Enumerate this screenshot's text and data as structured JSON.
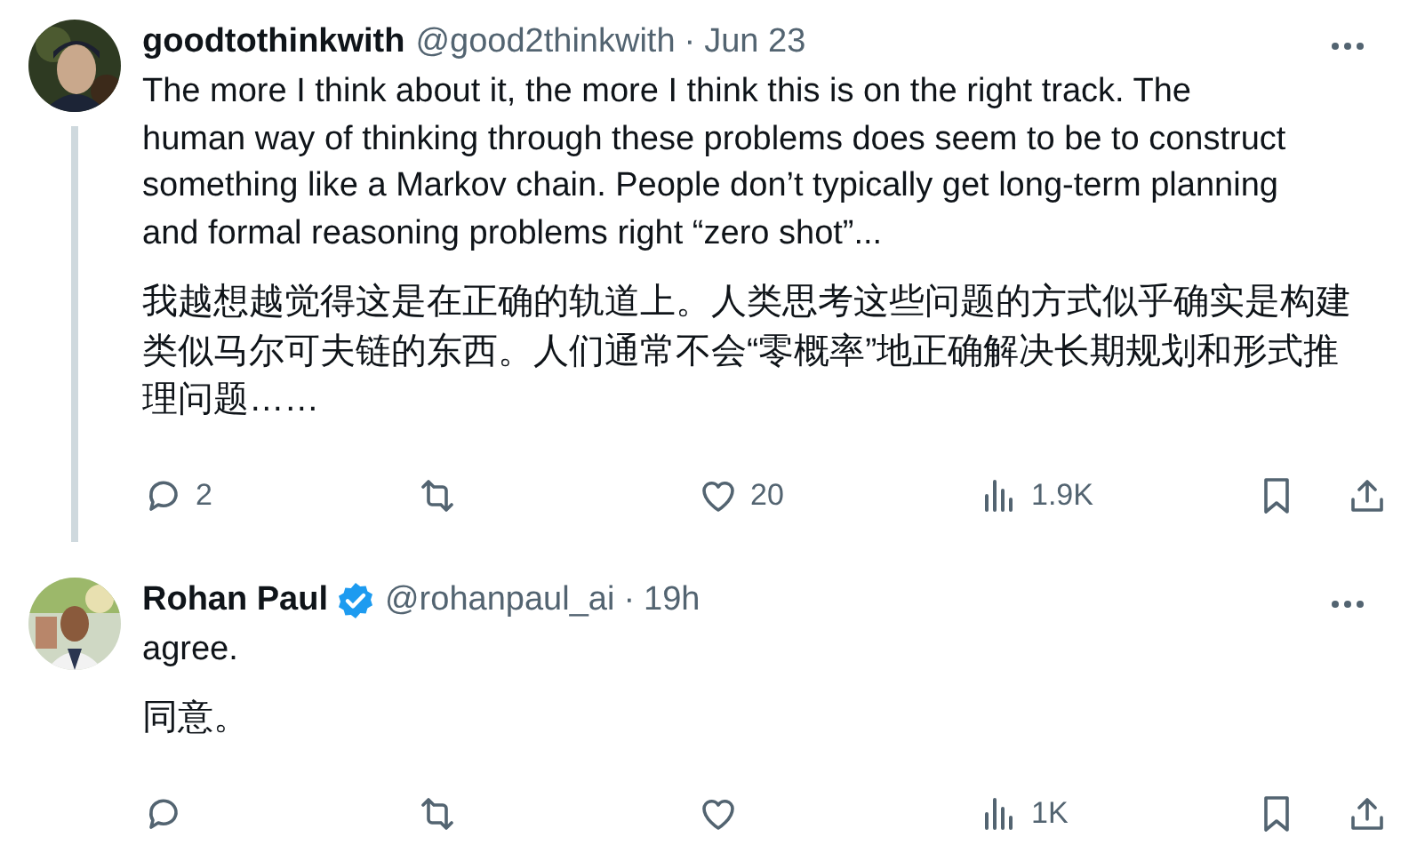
{
  "tweets": [
    {
      "name": "goodtothinkwith",
      "verified": false,
      "handle": "@good2thinkwith",
      "separator": "·",
      "time": "Jun 23",
      "thread_line": true,
      "paragraphs": [
        "The more I think about it, the more I think this is on the right track. The human way of thinking through these problems does seem to be to construct something like a Markov chain. People don’t typically get long-term planning and formal reasoning problems right “zero shot”...",
        "我越想越觉得这是在正确的轨道上。人类思考这些问题的方式似乎确实是构建类似马尔可夫链的东西。人们通常不会“零概率”地正确解决长期规划和形式推理问题……"
      ],
      "actions": [
        {
          "kind": "reply",
          "count": "2"
        },
        {
          "kind": "repost"
        },
        {
          "kind": "like",
          "count": "20"
        },
        {
          "kind": "views",
          "count": "1.9K"
        },
        {
          "kind": "bookmark"
        },
        {
          "kind": "share"
        }
      ]
    },
    {
      "name": "Rohan Paul",
      "verified": true,
      "handle": "@rohanpaul_ai",
      "separator": "·",
      "time": "19h",
      "thread_line": false,
      "paragraphs": [
        "agree.",
        "同意。"
      ],
      "actions": [
        {
          "kind": "reply"
        },
        {
          "kind": "repost"
        },
        {
          "kind": "like"
        },
        {
          "kind": "views",
          "count": "1K"
        },
        {
          "kind": "bookmark"
        },
        {
          "kind": "share"
        }
      ]
    }
  ]
}
